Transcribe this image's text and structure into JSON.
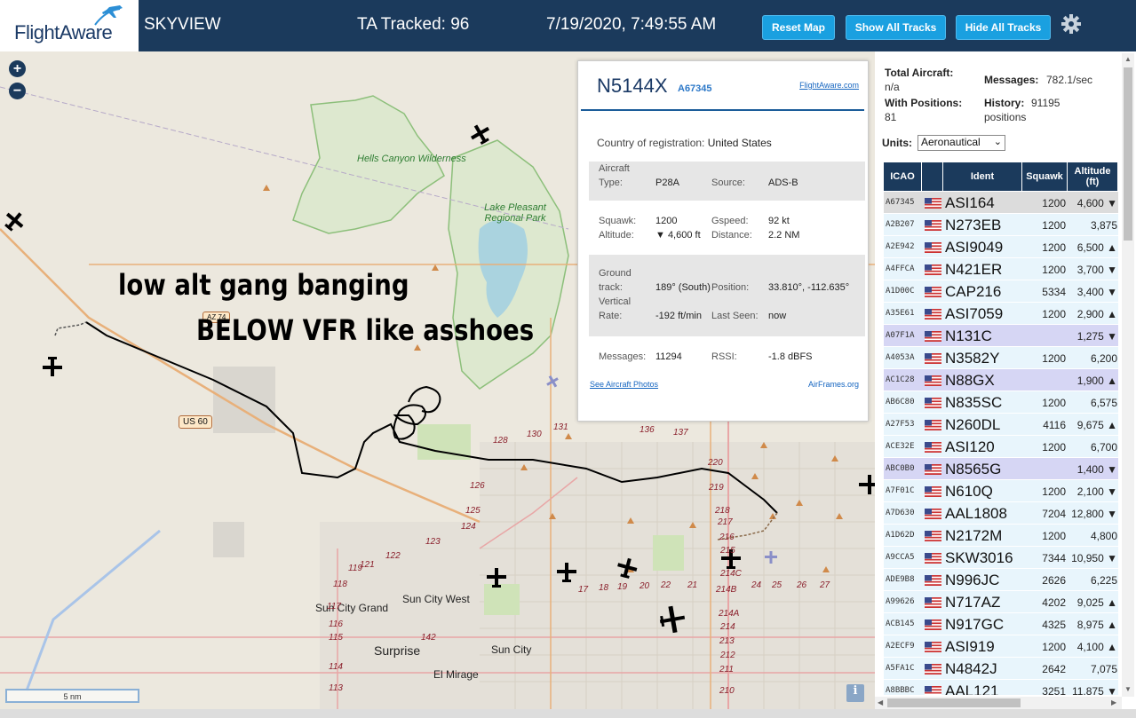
{
  "header": {
    "logo_text": "FlightAware",
    "app_name": "SKYVIEW",
    "ta_tracked": "TA Tracked: 96",
    "clock": "7/19/2020, 7:49:55 AM",
    "reset_label": "Reset Map",
    "show_label": "Show All Tracks",
    "hide_label": "Hide All Tracks",
    "settings_icon": "gear-icon"
  },
  "map": {
    "zoom_in": "+",
    "zoom_out": "−",
    "overlay_line1": "low alt gang banging",
    "overlay_line2": "BELOW VFR like asshoes",
    "scale": "5 nm",
    "info_icon": "i",
    "places": {
      "hells_canyon": "Hells Canyon Wilderness",
      "lake_pleasant": "Lake Pleasant Regional Park",
      "sun_city_grand": "Sun City Grand",
      "sun_city_west": "Sun City West",
      "surprise": "Surprise",
      "sun_city": "Sun City",
      "el_mirage": "El Mirage",
      "us60": "US 60",
      "az74": "AZ 74"
    },
    "roads": [
      "128",
      "130",
      "131",
      "136",
      "137",
      "126",
      "125",
      "124",
      "123",
      "122",
      "121",
      "220",
      "219",
      "218",
      "217",
      "216",
      "215",
      "214C",
      "214B",
      "214A",
      "214",
      "213",
      "212",
      "211",
      "210",
      "209",
      "119",
      "118",
      "117",
      "116",
      "115",
      "114",
      "113",
      "17",
      "18",
      "19",
      "20",
      "22",
      "24",
      "25",
      "26",
      "27",
      "21",
      "142"
    ]
  },
  "popup": {
    "callsign": "N5144X",
    "hex": "A67345",
    "fa_link": "FlightAware.com",
    "country_label": "Country of registration:",
    "country_value": "United States",
    "aircraft_type_label": "Aircraft Type:",
    "aircraft_type_label_1": "Aircraft",
    "aircraft_type_label_2": "Type:",
    "aircraft_type_value": "P28A",
    "source_label": "Source:",
    "source_value": "ADS-B",
    "squawk_label": "Squawk:",
    "squawk_value": "1200",
    "gspeed_label": "Gspeed:",
    "gspeed_value": "92 kt",
    "altitude_label": "Altitude:",
    "altitude_value": "▼ 4,600 ft",
    "distance_label": "Distance:",
    "distance_value": "2.2 NM",
    "ground_track_label_1": "Ground",
    "ground_track_label_2": "track:",
    "ground_track_value": "189° (South)",
    "position_label": "Position:",
    "position_value": "33.810°, -112.635°",
    "vertical_rate_label_1": "Vertical",
    "vertical_rate_label_2": "Rate:",
    "vertical_rate_value": "-192 ft/min",
    "last_seen_label": "Last Seen:",
    "last_seen_value": "now",
    "messages_label": "Messages:",
    "messages_value": "11294",
    "rssi_label": "RSSI:",
    "rssi_value": "-1.8 dBFS",
    "photos_link": "See Aircraft Photos",
    "airframes_link": "AirFrames.org"
  },
  "panel": {
    "total_aircraft_label": "Total Aircraft:",
    "total_aircraft_value": "n/a",
    "messages_label": "Messages:",
    "messages_value": "782.1/sec",
    "with_positions_label": "With Positions:",
    "with_positions_value": "81",
    "history_label": "History:",
    "history_value": "91195",
    "history_unit": "positions",
    "units_label": "Units:",
    "units_value": "Aeronautical",
    "columns": [
      "ICAO",
      "",
      "Ident",
      "Squawk",
      "Altitude (ft)"
    ],
    "rows": [
      {
        "icao": "A67345",
        "ident": "ASI164",
        "squawk": "1200",
        "alt": "4,600 ▼",
        "style": "sel"
      },
      {
        "icao": "A2B207",
        "ident": "N273EB",
        "squawk": "1200",
        "alt": "3,875",
        "style": "normal"
      },
      {
        "icao": "A2E942",
        "ident": "ASI9049",
        "squawk": "1200",
        "alt": "6,500 ▲",
        "style": "normal"
      },
      {
        "icao": "A4FFCA",
        "ident": "N421ER",
        "squawk": "1200",
        "alt": "3,700 ▼",
        "style": "normal"
      },
      {
        "icao": "A1D00C",
        "ident": "CAP216",
        "squawk": "5334",
        "alt": "3,400 ▼",
        "style": "normal"
      },
      {
        "icao": "A35E61",
        "ident": "ASI7059",
        "squawk": "1200",
        "alt": "2,900 ▲",
        "style": "normal"
      },
      {
        "icao": "A07F1A",
        "ident": "N131C",
        "squawk": "",
        "alt": "1,275 ▼",
        "style": "alt"
      },
      {
        "icao": "A4053A",
        "ident": "N3582Y",
        "squawk": "1200",
        "alt": "6,200",
        "style": "normal"
      },
      {
        "icao": "AC1C28",
        "ident": "N88GX",
        "squawk": "",
        "alt": "1,900 ▲",
        "style": "alt"
      },
      {
        "icao": "AB6C80",
        "ident": "N835SC",
        "squawk": "1200",
        "alt": "6,575",
        "style": "normal"
      },
      {
        "icao": "A27F53",
        "ident": "N260DL",
        "squawk": "4116",
        "alt": "9,675 ▲",
        "style": "normal"
      },
      {
        "icao": "ACE32E",
        "ident": "ASI120",
        "squawk": "1200",
        "alt": "6,700",
        "style": "normal"
      },
      {
        "icao": "ABC0B0",
        "ident": "N8565G",
        "squawk": "",
        "alt": "1,400 ▼",
        "style": "alt"
      },
      {
        "icao": "A7F01C",
        "ident": "N610Q",
        "squawk": "1200",
        "alt": "2,100 ▼",
        "style": "normal"
      },
      {
        "icao": "A7D630",
        "ident": "AAL1808",
        "squawk": "7204",
        "alt": "12,800 ▼",
        "style": "normal"
      },
      {
        "icao": "A1D62D",
        "ident": "N2172M",
        "squawk": "1200",
        "alt": "4,800",
        "style": "normal"
      },
      {
        "icao": "A9CCA5",
        "ident": "SKW3016",
        "squawk": "7344",
        "alt": "10,950 ▼",
        "style": "normal"
      },
      {
        "icao": "ADE9B8",
        "ident": "N996JC",
        "squawk": "2626",
        "alt": "6,225",
        "style": "normal"
      },
      {
        "icao": "A99626",
        "ident": "N717AZ",
        "squawk": "4202",
        "alt": "9,025 ▲",
        "style": "normal"
      },
      {
        "icao": "ACB145",
        "ident": "N917GC",
        "squawk": "4325",
        "alt": "8,975 ▲",
        "style": "normal"
      },
      {
        "icao": "A2ECF9",
        "ident": "ASI919",
        "squawk": "1200",
        "alt": "4,100 ▲",
        "style": "normal"
      },
      {
        "icao": "A5FA1C",
        "ident": "N4842J",
        "squawk": "2642",
        "alt": "7,075",
        "style": "normal"
      },
      {
        "icao": "A8BBBC",
        "ident": "AAL121",
        "squawk": "3251",
        "alt": "11,875 ▼",
        "style": "normal"
      }
    ]
  },
  "colors": {
    "header_bg": "#1b3a5c",
    "button_bg": "#1aa0e0",
    "map_bg": "#ece8de",
    "row_normal": "#e8f5fc",
    "row_alt": "#d6d6f4",
    "row_selected": "#dcdcdc",
    "track_line": "#000000"
  }
}
